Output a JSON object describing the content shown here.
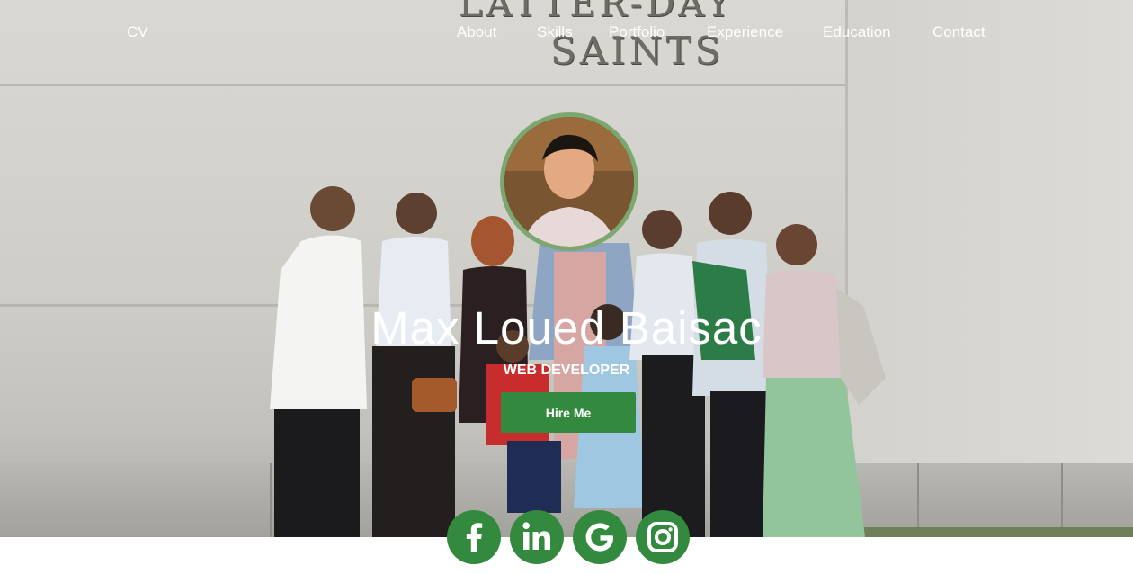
{
  "nav": {
    "brand": "CV",
    "items": [
      {
        "label": "About"
      },
      {
        "label": "Skills"
      },
      {
        "label": "Portfolio"
      },
      {
        "label": "Experience"
      },
      {
        "label": "Education"
      },
      {
        "label": "Contact"
      }
    ]
  },
  "hero": {
    "background_sign": [
      "LATTER-DAY",
      "SAINTS"
    ],
    "name": "Max Loued Baisac",
    "role": "WEB DEVELOPER",
    "cta_label": "Hire Me"
  },
  "social": [
    {
      "icon": "facebook-icon"
    },
    {
      "icon": "linkedin-icon"
    },
    {
      "icon": "google-icon"
    },
    {
      "icon": "instagram-icon"
    }
  ],
  "colors": {
    "accent": "#338a3e",
    "avatar_ring": "#7aa86f",
    "text": "#ffffff"
  }
}
